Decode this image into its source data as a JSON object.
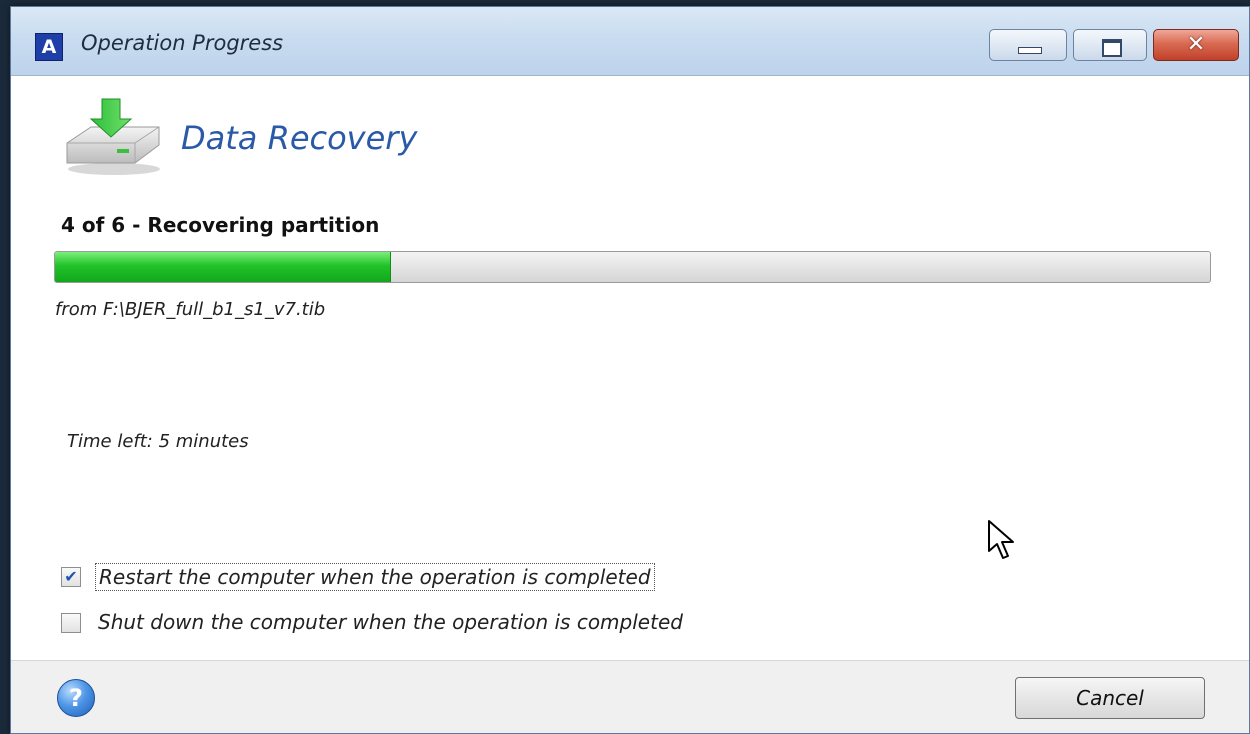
{
  "window": {
    "title": "Operation Progress",
    "app_icon_letter": "A",
    "buttons": {
      "minimize": "minimize",
      "maximize": "maximize",
      "close": "✕"
    }
  },
  "header": {
    "title": "Data Recovery",
    "icon": "hard-drive-download-icon"
  },
  "progress": {
    "step_text": "4 of 6 - Recovering partition",
    "percent": 29,
    "source": "from F:\\BJER_full_b1_s1_v7.tib",
    "time_left": "Time left: 5 minutes",
    "fill_color": "#22c22a"
  },
  "options": [
    {
      "label": "Restart the computer when the operation is completed",
      "checked": true
    },
    {
      "label": "Shut down the computer when the operation is completed",
      "checked": false
    }
  ],
  "footer": {
    "help_symbol": "?",
    "cancel_label": "Cancel"
  }
}
